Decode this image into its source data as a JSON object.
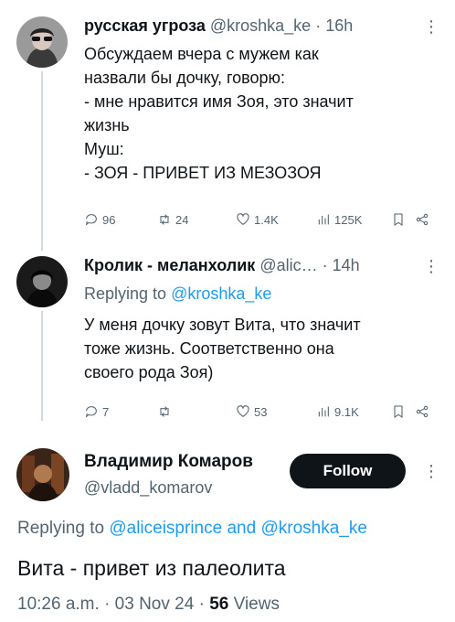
{
  "tweet1": {
    "name": "русская угроза",
    "handle": "@kroshka_ke",
    "time": "16h",
    "text": "Обсуждаем вчера с мужем как\nназвали бы дочку, говорю:\n- мне нравится имя Зоя, это значит\nжизнь\nМуш:\n- ЗОЯ - ПРИВЕТ ИЗ МЕЗОЗОЯ",
    "replies": "96",
    "retweets": "24",
    "likes": "1.4K",
    "views": "125K"
  },
  "tweet2": {
    "name": "Кролик - меланхолик",
    "handle": "@alic…",
    "time": "14h",
    "replying_prefix": "Replying to",
    "replying_handle": "@kroshka_ke",
    "text": "У меня дочку зовут Вита, что значит\nтоже жизнь. Соответственно она\nсвоего рода Зоя)",
    "replies": "7",
    "retweets": "",
    "likes": "53",
    "views": "9.1K"
  },
  "main": {
    "name": "Владимир Комаров",
    "handle": "@vladd_komarov",
    "follow_label": "Follow",
    "replying_prefix": "Replying to",
    "replying_handle1": "@aliceisprince",
    "replying_and": "and",
    "replying_handle2": "@kroshka_ke",
    "text": "Вита - привет из палеолита",
    "time": "10:26 a.m.",
    "date": "03 Nov 24",
    "views_count": "56",
    "views_label": "Views"
  },
  "icons": {
    "more": "more-vertical-icon",
    "reply": "reply-icon",
    "retweet": "retweet-icon",
    "like": "heart-icon",
    "views": "analytics-icon",
    "bookmark": "bookmark-icon",
    "share": "share-icon"
  }
}
